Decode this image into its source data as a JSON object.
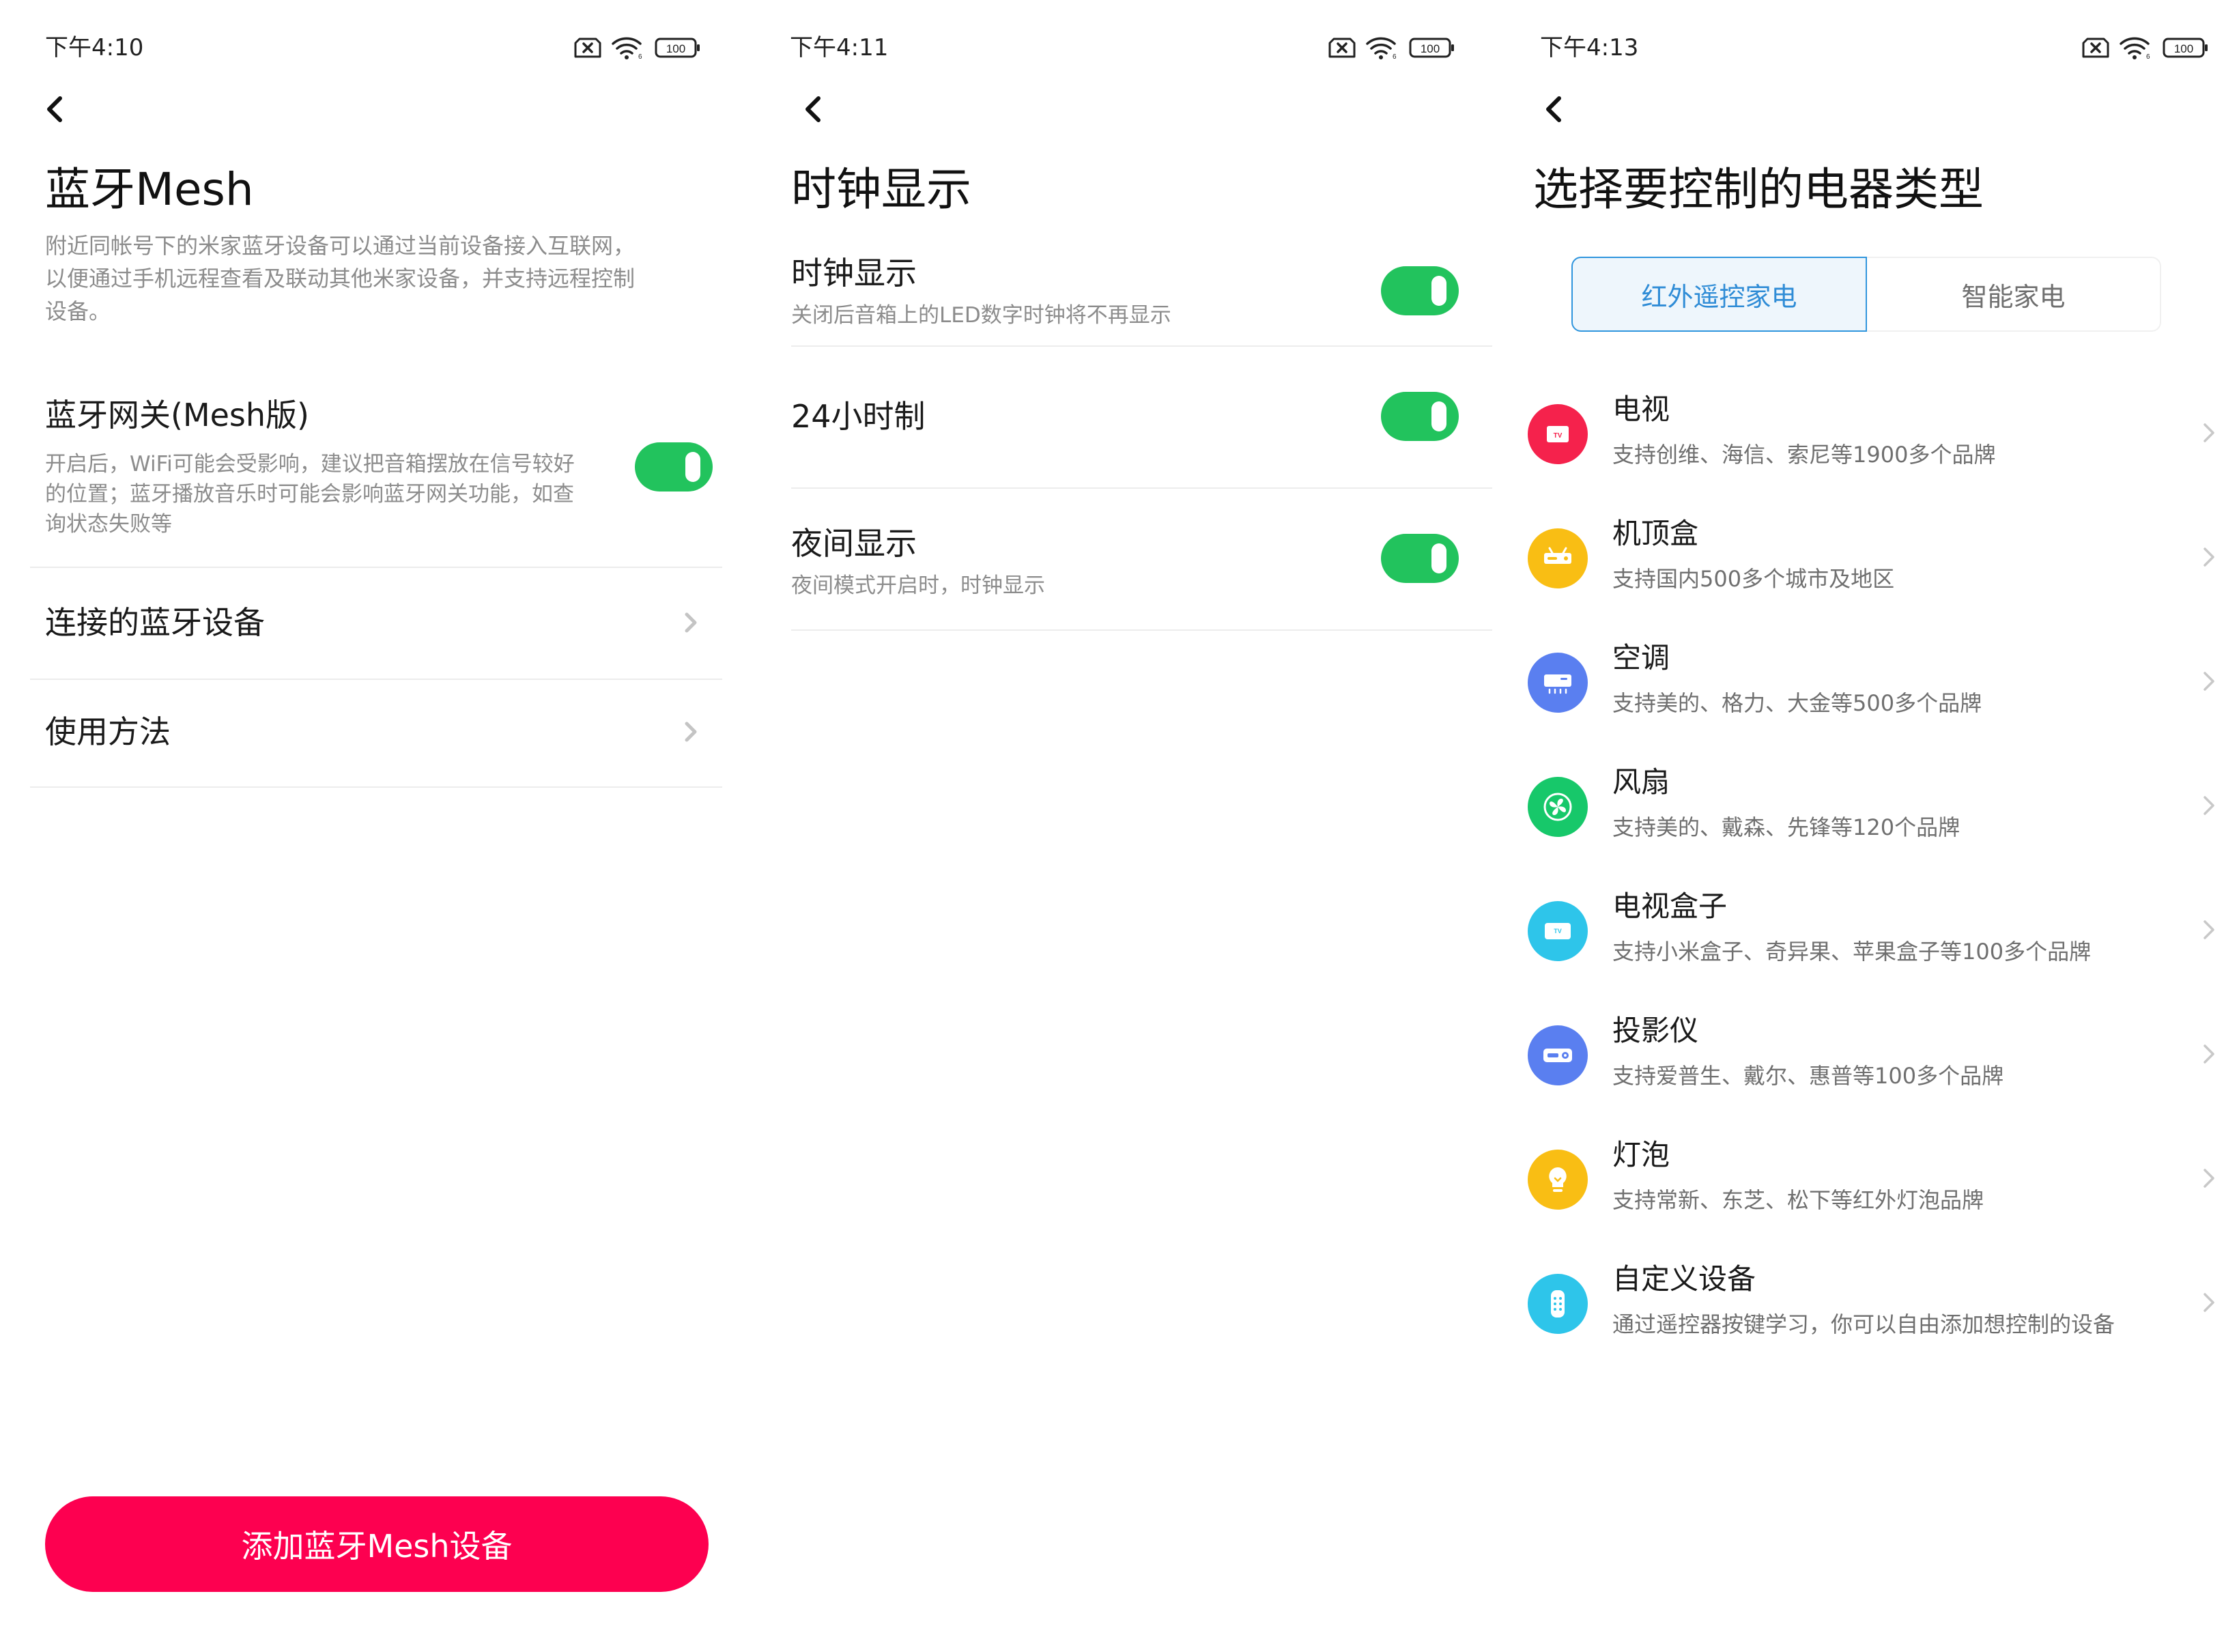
{
  "screen1": {
    "status_time": "下午4:10",
    "battery": "100",
    "title": "蓝牙Mesh",
    "description_lines": [
      "附近同帐号下的米家蓝牙设备可以通过当前设备接入互联网，",
      "以便通过手机远程查看及联动其他米家设备，并支持远程控制",
      "设备。"
    ],
    "gateway": {
      "title": "蓝牙网关(Mesh版)",
      "desc_lines": [
        "开启后，WiFi可能会受影响，建议把音箱摆放在信号较好",
        "的位置；蓝牙播放音乐时可能会影响蓝牙网关功能，如查",
        "询状态失败等"
      ],
      "enabled": true
    },
    "menu": [
      {
        "label": "连接的蓝牙设备"
      },
      {
        "label": "使用方法"
      }
    ],
    "add_button": "添加蓝牙Mesh设备"
  },
  "screen2": {
    "status_time": "下午4:11",
    "battery": "100",
    "title": "时钟显示",
    "settings": [
      {
        "label": "时钟显示",
        "sub": "关闭后音箱上的LED数字时钟将不再显示",
        "enabled": true
      },
      {
        "label": "24小时制",
        "sub": "",
        "enabled": true
      },
      {
        "label": "夜间显示",
        "sub": "夜间模式开启时，时钟显示",
        "enabled": true
      }
    ]
  },
  "screen3": {
    "status_time": "下午4:13",
    "battery": "100",
    "title": "选择要控制的电器类型",
    "tabs": [
      {
        "label": "红外遥控家电",
        "active": true
      },
      {
        "label": "智能家电",
        "active": false
      }
    ],
    "devices": [
      {
        "label": "电视",
        "sub": "支持创维、海信、索尼等1900多个品牌",
        "icon": "tv-icon",
        "color": "#f5224c"
      },
      {
        "label": "机顶盒",
        "sub": "支持国内500多个城市及地区",
        "icon": "set-top-box-icon",
        "color": "#f9be14"
      },
      {
        "label": "空调",
        "sub": "支持美的、格力、大金等500多个品牌",
        "icon": "air-conditioner-icon",
        "color": "#5a7ff0"
      },
      {
        "label": "风扇",
        "sub": "支持美的、戴森、先锋等120个品牌",
        "icon": "fan-icon",
        "color": "#17c86a"
      },
      {
        "label": "电视盒子",
        "sub": "支持小米盒子、奇异果、苹果盒子等100多个品牌",
        "icon": "tv-box-icon",
        "color": "#2ec5ea"
      },
      {
        "label": "投影仪",
        "sub": "支持爱普生、戴尔、惠普等100多个品牌",
        "icon": "projector-icon",
        "color": "#5a7ff0"
      },
      {
        "label": "灯泡",
        "sub": "支持常新、东芝、松下等红外灯泡品牌",
        "icon": "light-bulb-icon",
        "color": "#f9be14"
      },
      {
        "label": "自定义设备",
        "sub": "通过遥控器按键学习，你可以自由添加想控制的设备",
        "icon": "remote-control-icon",
        "color": "#2ec5ea"
      }
    ]
  }
}
